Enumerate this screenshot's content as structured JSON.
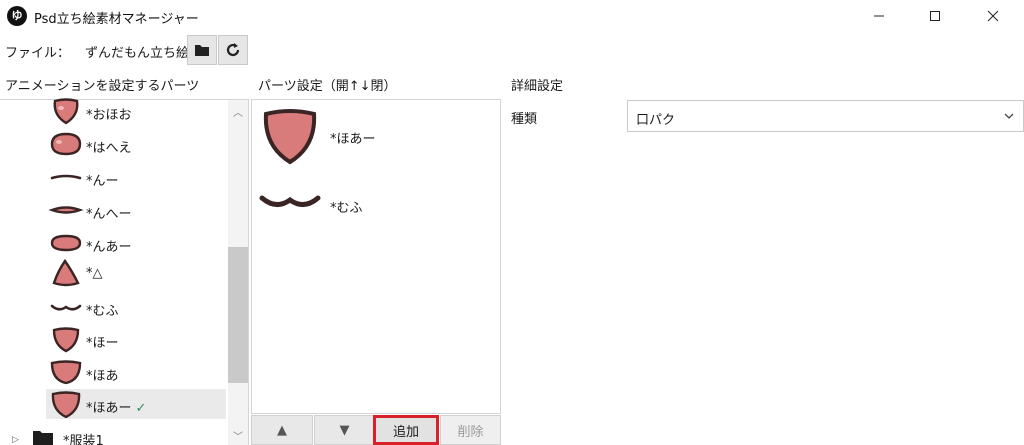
{
  "window": {
    "title": "Psd立ち絵素材マネージャー",
    "app_icon_text": "ゆ"
  },
  "filebar": {
    "label": "ファイル：",
    "file_name": "ずんだもん立ち絵素"
  },
  "headers": {
    "anim_parts": "アニメーションを設定するパーツ",
    "parts_setting": "パーツ設定（開↑↓閉）",
    "detail_setting": "詳細設定"
  },
  "tree": {
    "items": [
      {
        "label": "*おほお",
        "icon": "mouth-ohoo-icon"
      },
      {
        "label": "*はへえ",
        "icon": "mouth-hahee-icon"
      },
      {
        "label": "*んー",
        "icon": "mouth-n-line-icon"
      },
      {
        "label": "*んへー",
        "icon": "mouth-nhe-icon"
      },
      {
        "label": "*んあー",
        "icon": "mouth-naa-icon"
      },
      {
        "label": "*△",
        "icon": "mouth-triangle-icon"
      },
      {
        "label": "*むふ",
        "icon": "mouth-mufu-icon"
      },
      {
        "label": "*ほー",
        "icon": "mouth-hoo-icon"
      },
      {
        "label": "*ほあ",
        "icon": "mouth-hoa-icon"
      },
      {
        "label": "*ほあー",
        "icon": "mouth-hoaa-icon",
        "selected": true,
        "checked": true
      }
    ],
    "folder_label": "*服装1"
  },
  "parts": {
    "items": [
      {
        "label": "*ほあー"
      },
      {
        "label": "*むふ"
      }
    ],
    "buttons": {
      "up": "▲",
      "down": "▼",
      "add": "追加",
      "delete": "削除"
    }
  },
  "detail": {
    "kind_label": "種類",
    "kind_value": "口パク"
  },
  "colors": {
    "mouth_fill": "#d97b7b",
    "mouth_outline": "#3a2424",
    "highlight_border": "#d8212b",
    "check": "#2e8b57"
  }
}
